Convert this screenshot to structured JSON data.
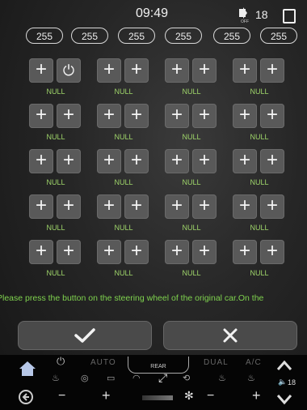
{
  "status": {
    "time": "09:49",
    "icon_sublabel": "OFF",
    "value": "18"
  },
  "pills": [
    "255",
    "255",
    "255",
    "255",
    "255",
    "255"
  ],
  "grid": {
    "null_label": "NULL",
    "plus_symbol": "+",
    "first_button_icon": "power-icon"
  },
  "hint": "Please press the button on the steering wheel of the original car.On the",
  "actions": {
    "confirm_icon": "checkmark-icon",
    "cancel_icon": "close-icon"
  },
  "climate": {
    "auto_label": "AUTO",
    "rear_label": "REAR",
    "dual_label": "DUAL",
    "ac_label": "A/C",
    "minus": "−",
    "plus": "+",
    "volume": "18"
  },
  "colors": {
    "accent": "#7fd34e",
    "button_bg": "#595959",
    "bar_bg": "#050505"
  }
}
